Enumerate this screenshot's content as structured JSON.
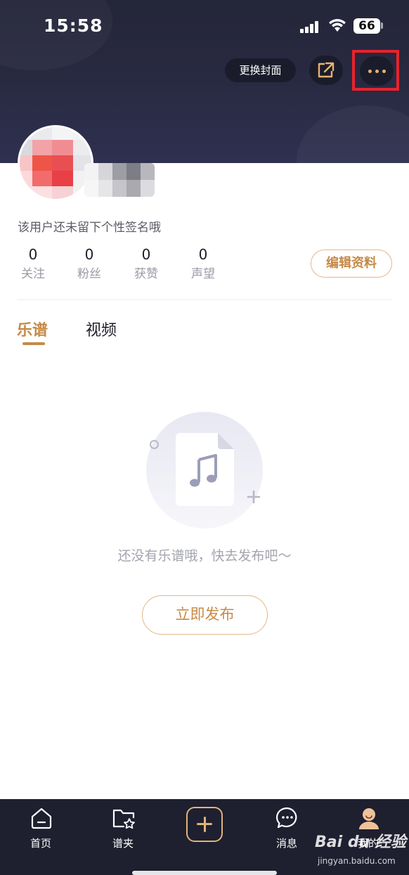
{
  "status_bar": {
    "time": "15:58",
    "battery": "66"
  },
  "header": {
    "change_cover_label": "更换封面",
    "share_icon": "share-export-icon",
    "more_icon": "more-dots-icon",
    "highlight_color": "#e8232b"
  },
  "profile": {
    "signature": "该用户还未留下个性签名哦",
    "stats": [
      {
        "value": "0",
        "label": "关注"
      },
      {
        "value": "0",
        "label": "粉丝"
      },
      {
        "value": "0",
        "label": "获赞"
      },
      {
        "value": "0",
        "label": "声望"
      }
    ],
    "edit_label": "编辑资料"
  },
  "tabs": [
    {
      "label": "乐谱",
      "active": true
    },
    {
      "label": "视频",
      "active": false
    }
  ],
  "empty_state": {
    "icon": "music-note-document-icon",
    "message": "还没有乐谱哦，快去发布吧～",
    "publish_label": "立即发布"
  },
  "bottom_nav": {
    "items": [
      {
        "label": "首页",
        "icon": "home-icon"
      },
      {
        "label": "谱夹",
        "icon": "folder-star-icon"
      },
      {
        "label": "",
        "icon": "add-icon"
      },
      {
        "label": "消息",
        "icon": "message-icon"
      },
      {
        "label": "我的",
        "icon": "profile-icon"
      }
    ]
  },
  "watermark": {
    "main": "Bai du 经验",
    "sub": "jingyan.baidu.com"
  },
  "colors": {
    "accent": "#c58a47",
    "header_bg": "#242538",
    "nav_bg": "#1e1f2f"
  }
}
